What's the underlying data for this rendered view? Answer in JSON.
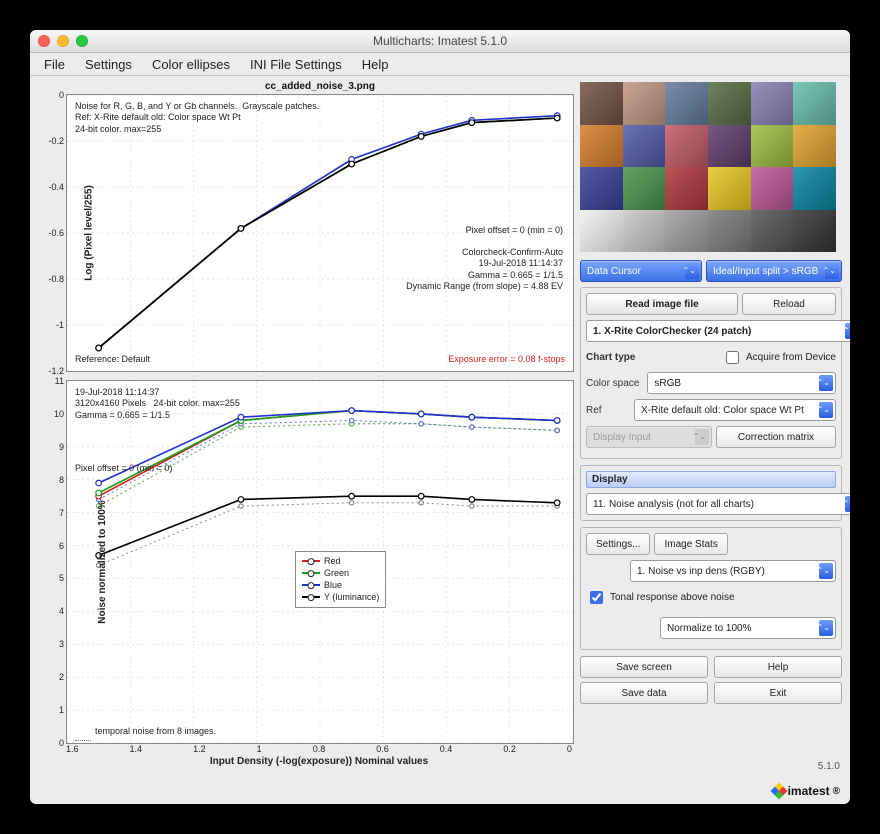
{
  "window": {
    "title": "Multicharts:  Imatest 5.1.0"
  },
  "menu": [
    "File",
    "Settings",
    "Color ellipses",
    "INI File Settings",
    "Help"
  ],
  "chart_data": [
    {
      "type": "line",
      "title": "cc_added_noise_3.png",
      "ylabel": "Log (Pixel level/255)",
      "xlim": [
        1.6,
        0.0
      ],
      "ylim": [
        -1.2,
        0.0
      ],
      "x": [
        1.5,
        1.05,
        0.7,
        0.48,
        0.32,
        0.05
      ],
      "series": [
        {
          "name": "R",
          "color": "#d42020",
          "values": [
            -1.1,
            -0.58,
            -0.3,
            -0.18,
            -0.12,
            -0.1
          ]
        },
        {
          "name": "G",
          "color": "#18a018",
          "values": [
            -1.1,
            -0.58,
            -0.3,
            -0.18,
            -0.12,
            -0.1
          ]
        },
        {
          "name": "B",
          "color": "#2030d0",
          "values": [
            -1.1,
            -0.58,
            -0.28,
            -0.17,
            -0.11,
            -0.09
          ]
        },
        {
          "name": "Y",
          "color": "#000000",
          "values": [
            -1.1,
            -0.58,
            -0.3,
            -0.18,
            -0.12,
            -0.1
          ]
        }
      ],
      "annotations": {
        "topleft": "Noise for R, G, B, and Y or Gb channels.  Grayscale patches.\nRef: X-Rite default old: Color space Wt Pt\n24-bit color. max=255",
        "right1": "Pixel offset = 0  (min = 0)",
        "right2": "Colorcheck-Confirm-Auto\n19-Jul-2018 11:14:37\nGamma = 0.665 = 1/1.5\nDynamic Range (from slope) = 4.88 EV",
        "botleft": "Reference: Default",
        "botright": "Exposure error = 0.08 f-stops"
      }
    },
    {
      "type": "line",
      "ylabel": "Noise  normalized to 100%",
      "xlabel": "Input Density (-log(exposure))   Nominal values",
      "xlim": [
        1.6,
        0.0
      ],
      "ylim": [
        0,
        11
      ],
      "x": [
        1.5,
        1.05,
        0.7,
        0.48,
        0.32,
        0.05
      ],
      "series": [
        {
          "name": "Red",
          "color": "#d42020",
          "values": [
            7.5,
            9.8,
            10.1,
            10.0,
            9.9,
            9.8
          ]
        },
        {
          "name": "Green",
          "color": "#18a018",
          "values": [
            7.6,
            9.8,
            10.1,
            10.0,
            9.9,
            9.8
          ]
        },
        {
          "name": "Blue",
          "color": "#2030d0",
          "values": [
            7.9,
            9.9,
            10.1,
            10.0,
            9.9,
            9.8
          ]
        },
        {
          "name": "Y (luminance)",
          "color": "#000000",
          "values": [
            5.7,
            7.4,
            7.5,
            7.5,
            7.4,
            7.3
          ]
        }
      ],
      "temporal": [
        {
          "color": "#d06060",
          "values": [
            7.2,
            9.6,
            9.7,
            9.7,
            9.6,
            9.5
          ]
        },
        {
          "color": "#60c060",
          "values": [
            7.2,
            9.6,
            9.7,
            9.7,
            9.6,
            9.5
          ]
        },
        {
          "color": "#6070d0",
          "values": [
            7.4,
            9.7,
            9.8,
            9.7,
            9.6,
            9.5
          ]
        },
        {
          "color": "#888888",
          "values": [
            5.4,
            7.2,
            7.3,
            7.3,
            7.2,
            7.2
          ]
        }
      ],
      "annotations": {
        "topleft": "19-Jul-2018 11:14:37\n3120x4160 Pixels   24-bit color. max=255\nGamma = 0.665 = 1/1.5",
        "left1": "Pixel offset = 0  (min = 0)",
        "botleft": "temporal noise from 8 images."
      }
    }
  ],
  "colorchecker": [
    "#735244",
    "#c29682",
    "#627a9d",
    "#576c43",
    "#8580b1",
    "#67bdaa",
    "#d67e2c",
    "#505ba6",
    "#c15a63",
    "#5e3c6c",
    "#9dbc40",
    "#e0a32e",
    "#383d96",
    "#469449",
    "#af363c",
    "#e7c71f",
    "#bb5695",
    "#0885a1",
    "#f3f3f2",
    "#c8c8c8",
    "#a0a0a0",
    "#7a7a79",
    "#555555",
    "#343434"
  ],
  "controls": {
    "topsel1": "Data Cursor",
    "topsel2": "Ideal/Input split > sRGB",
    "read_image": "Read image file",
    "reload": "Reload",
    "chart_target": "1.  X-Rite ColorChecker (24 patch)",
    "chart_type_label": "Chart type",
    "acquire": "Acquire from Device",
    "color_space_label": "Color space",
    "color_space": "sRGB",
    "ref_label": "Ref",
    "ref": "X-Rite default old: Color space Wt Pt",
    "display_input": "Display Input",
    "correction_matrix": "Correction matrix",
    "display_label": "Display",
    "display_select": "11. Noise analysis (not for all charts)",
    "settings": "Settings...",
    "image_stats": "Image Stats",
    "noise_plot": "1.  Noise vs inp dens (RGBY)",
    "tonal_checkbox": "Tonal response above noise",
    "normalize": "Normalize to 100%",
    "save_screen": "Save screen",
    "help": "Help",
    "save_data": "Save data",
    "exit": "Exit"
  },
  "version": "5.1.0",
  "brand": "imatest"
}
